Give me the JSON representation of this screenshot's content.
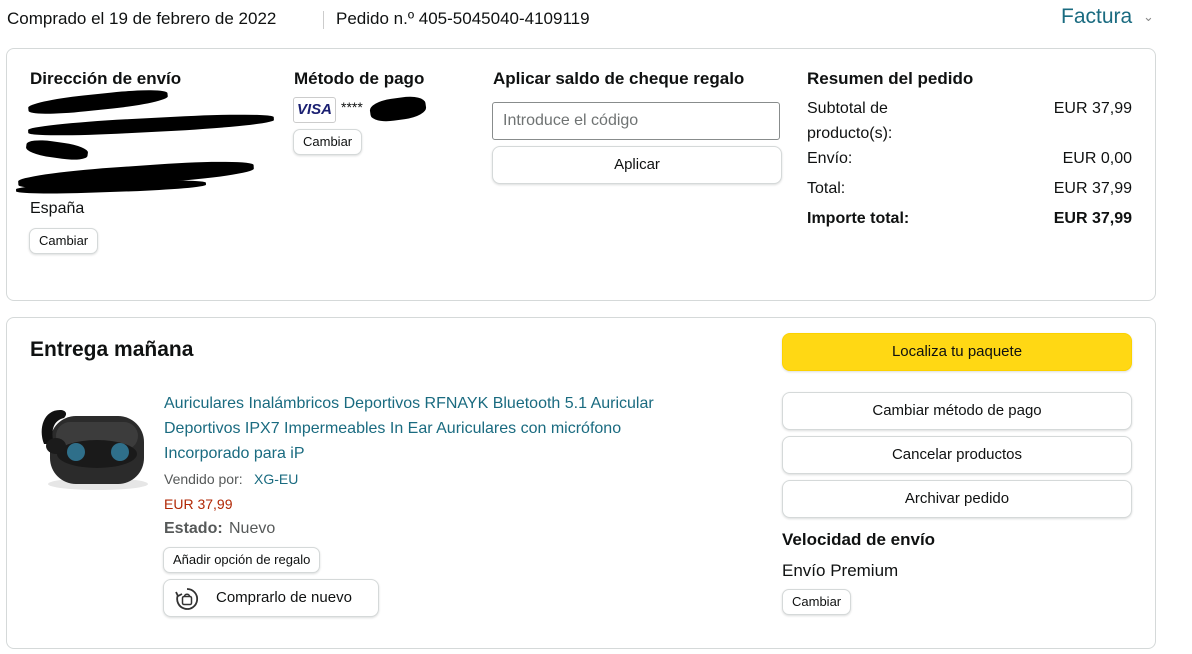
{
  "header": {
    "purchase_date": "Comprado el 19 de febrero de 2022",
    "order_number": "Pedido n.º 405-5045040-4109119",
    "invoice_label": "Factura",
    "invoice_chevron": "⌄"
  },
  "shipping": {
    "title": "Dirección de envío",
    "country": "España",
    "change_label": "Cambiar"
  },
  "payment": {
    "title": "Método de pago",
    "card_brand": "VISA",
    "card_masked": "****",
    "change_label": "Cambiar"
  },
  "gift_card": {
    "title": "Aplicar saldo de cheque regalo",
    "placeholder": "Introduce el código",
    "apply_label": "Aplicar"
  },
  "summary": {
    "title": "Resumen del pedido",
    "subtotal_label_1": "Subtotal de",
    "subtotal_label_2": "producto(s):",
    "subtotal_value": "EUR 37,99",
    "shipping_label": "Envío:",
    "shipping_value": "EUR 0,00",
    "total_label": "Total:",
    "total_value": "EUR 37,99",
    "grand_total_label": "Importe total:",
    "grand_total_value": "EUR 37,99"
  },
  "delivery": {
    "title": "Entrega mañana",
    "product_title_1": "Auriculares Inalámbricos Deportivos RFNAYK Bluetooth 5.1 Auricular",
    "product_title_2": "Deportivos IPX7 Impermeables In Ear Auriculares con micrófono",
    "product_title_3": "Incorporado para iP",
    "sold_by_label": "Vendido por:",
    "seller": "XG-EU",
    "price": "EUR 37,99",
    "condition_label": "Estado:",
    "condition_value": "Nuevo",
    "gift_option_label": "Añadir opción de regalo",
    "buy_again_label": "Comprarlo de nuevo"
  },
  "actions": {
    "track": "Localiza tu paquete",
    "change_payment": "Cambiar método de pago",
    "cancel": "Cancelar productos",
    "archive": "Archivar pedido"
  },
  "shipping_speed": {
    "title": "Velocidad de envío",
    "value": "Envío Premium",
    "change_label": "Cambiar"
  },
  "colors": {
    "link": "#1a6b80",
    "price": "#b12704",
    "primary_button": "#ffd814"
  }
}
